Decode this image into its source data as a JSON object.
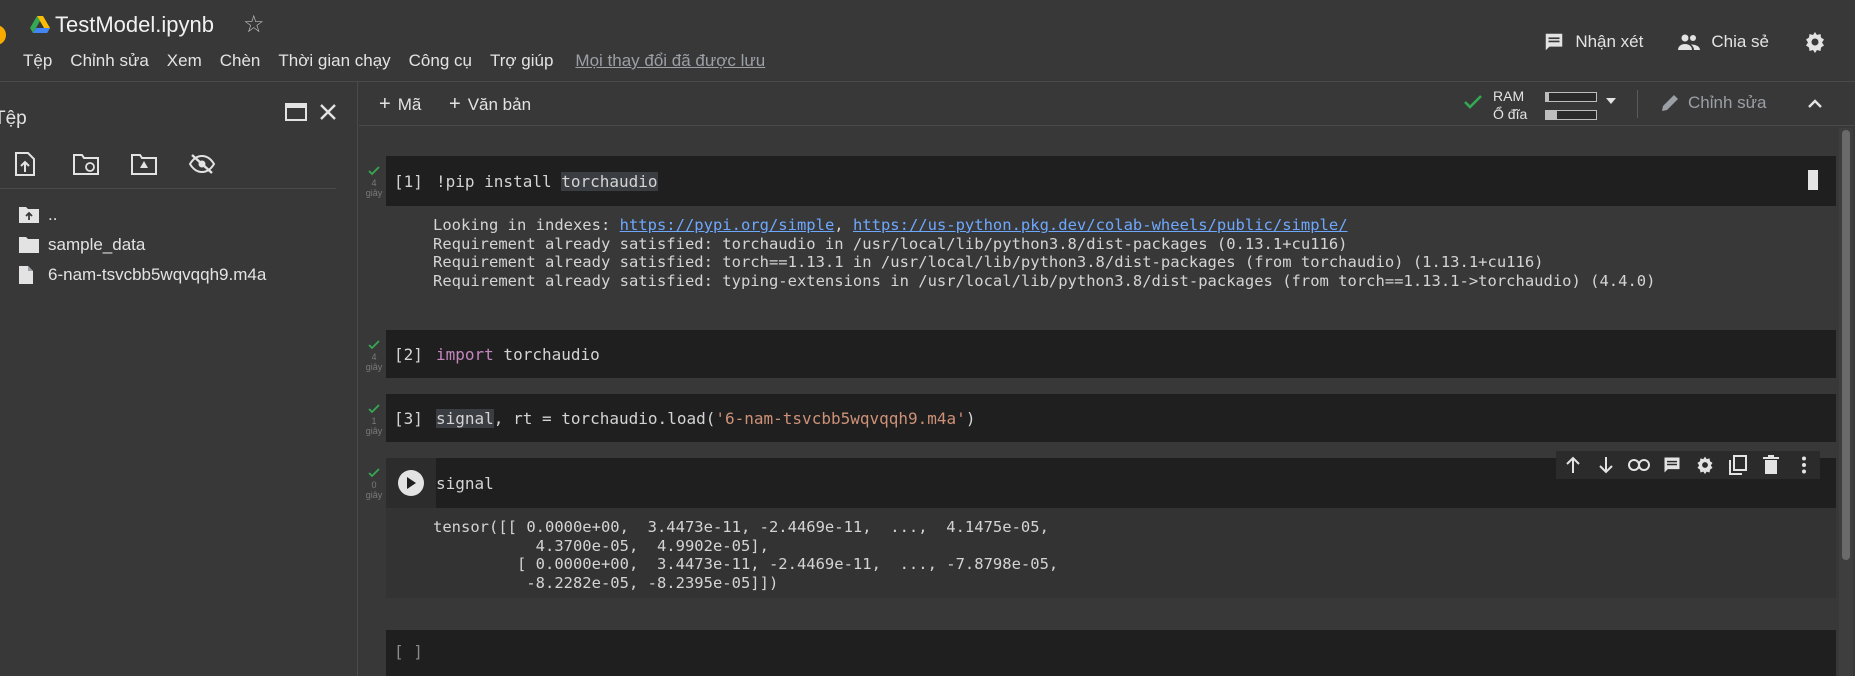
{
  "header": {
    "title": "TestModel.ipynb",
    "menu": [
      "Tệp",
      "Chỉnh sửa",
      "Xem",
      "Chèn",
      "Thời gian chạy",
      "Công cụ",
      "Trợ giúp"
    ],
    "saved_status": "Mọi thay đổi đã được lưu",
    "comment_label": "Nhận xét",
    "share_label": "Chia sẻ"
  },
  "sidebar": {
    "title": "Tệp",
    "files": [
      {
        "name": "..",
        "icon": "folder-up-icon"
      },
      {
        "name": "sample_data",
        "icon": "folder-icon"
      },
      {
        "name": "6-nam-tsvcbb5wqvqqh9.m4a",
        "icon": "file-icon"
      }
    ]
  },
  "toolbar": {
    "add_code": "Mã",
    "add_text": "Văn bản",
    "ram_label": "RAM",
    "disk_label": "Ổ đĩa",
    "ram_usage": 0.06,
    "disk_usage": 0.22,
    "edit_label": "Chỉnh sửa"
  },
  "cells": {
    "c1": {
      "count": "[1]",
      "code_prefix": "!pip install ",
      "code_word": "torchaudio",
      "time": "4",
      "unit": "giây",
      "out_prefix": "Looking in indexes: ",
      "link1": "https://pypi.org/simple",
      "sep": ", ",
      "link2": "https://us-python.pkg.dev/colab-wheels/public/simple/",
      "out_line2": "Requirement already satisfied: torchaudio in /usr/local/lib/python3.8/dist-packages (0.13.1+cu116)",
      "out_line3": "Requirement already satisfied: torch==1.13.1 in /usr/local/lib/python3.8/dist-packages (from torchaudio) (1.13.1+cu116)",
      "out_line4": "Requirement already satisfied: typing-extensions in /usr/local/lib/python3.8/dist-packages (from torch==1.13.1->torchaudio) (4.4.0)"
    },
    "c2": {
      "count": "[2]",
      "keyword": "import",
      "module": " torchaudio",
      "time": "4",
      "unit": "giây"
    },
    "c3": {
      "count": "[3]",
      "var": "signal",
      "code_mid": ", rt = torchaudio.load(",
      "string": "'6-nam-tsvcbb5wqvqqh9.m4a'",
      "code_end": ")",
      "time": "1",
      "unit": "giây"
    },
    "c4": {
      "code": "signal",
      "time": "0",
      "unit": "giây",
      "output": "tensor([[ 0.0000e+00,  3.4473e-11, -2.4469e-11,  ...,  4.1475e-05,\n           4.3700e-05,  4.9902e-05],\n         [ 0.0000e+00,  3.4473e-11, -2.4469e-11,  ..., -7.8798e-05,\n          -8.2282e-05, -8.2395e-05]])"
    },
    "c5": {
      "count": "[ ]"
    }
  }
}
